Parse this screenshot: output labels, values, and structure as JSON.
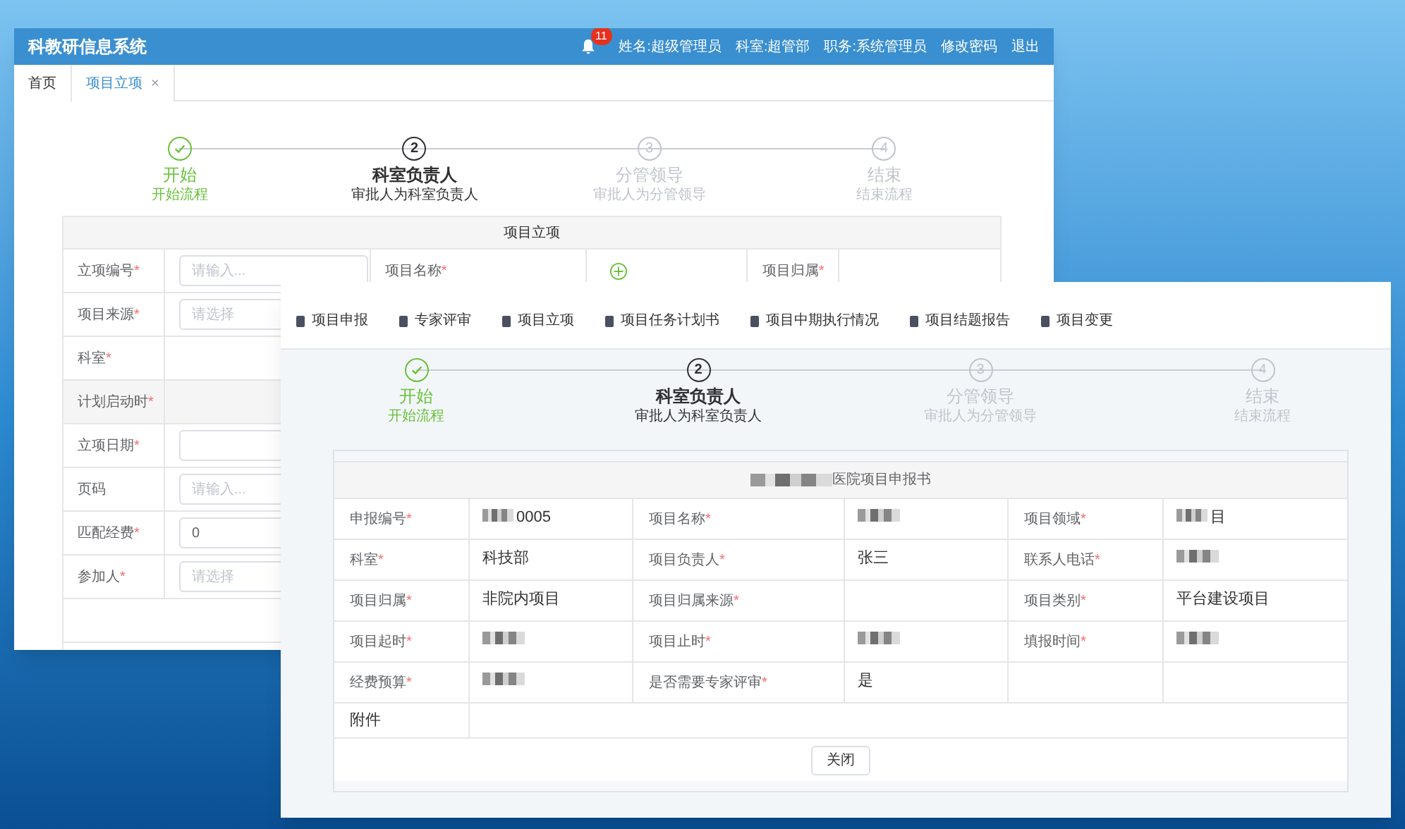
{
  "back_window": {
    "title": "科教研信息系统",
    "notification_count": "11",
    "user_links": [
      "姓名:超级管理员",
      "科室:超管部",
      "职务:系统管理员",
      "修改密码",
      "退出"
    ],
    "tabs": [
      {
        "label": "首页",
        "selected": false
      },
      {
        "label": "项目立项",
        "selected": true,
        "close": "×"
      }
    ],
    "steps": [
      {
        "title": "开始",
        "subtitle": "开始流程",
        "kind": "done"
      },
      {
        "number": "2",
        "title": "科室负责人",
        "subtitle": "审批人为科室负责人",
        "kind": "current"
      },
      {
        "number": "3",
        "title": "分管领导",
        "subtitle": "审批人为分管领导",
        "kind": "pending"
      },
      {
        "number": "4",
        "title": "结束",
        "subtitle": "结束流程",
        "kind": "pending"
      }
    ],
    "form": {
      "title": "项目立项",
      "top_row": [
        {
          "label": "立项编号",
          "mark": "*",
          "placeholder": "请输入..."
        },
        {
          "label": "项目名称",
          "mark": "*",
          "add_button": true
        },
        {
          "label": "项目归属",
          "mark": "*"
        }
      ],
      "rows": [
        {
          "label": "项目来源",
          "mark": "*",
          "placeholder": "请选择"
        },
        {
          "label": "科室",
          "mark": "*"
        },
        {
          "label": "计划启动时",
          "mark": "*",
          "shaded": true
        },
        {
          "label": "立项日期",
          "mark": "*",
          "input": true
        },
        {
          "label": "页码",
          "placeholder": "请输入..."
        },
        {
          "label": "匹配经费",
          "mark": "*",
          "value": "0"
        },
        {
          "label": "参加人",
          "mark": "*",
          "placeholder": "请选择"
        }
      ]
    }
  },
  "front_window": {
    "nav": [
      "项目申报",
      "专家评审",
      "项目立项",
      "项目任务计划书",
      "项目中期执行情况",
      "项目结题报告",
      "项目变更"
    ],
    "steps": [
      {
        "title": "开始",
        "subtitle": "开始流程",
        "kind": "done"
      },
      {
        "number": "2",
        "title": "科室负责人",
        "subtitle": "审批人为科室负责人",
        "kind": "current"
      },
      {
        "number": "3",
        "title": "分管领导",
        "subtitle": "审批人为分管领导",
        "kind": "pending"
      },
      {
        "number": "4",
        "title": "结束",
        "subtitle": "结束流程",
        "kind": "pending"
      }
    ],
    "form": {
      "title": "医院项目申报书",
      "title_redacted": true,
      "rows": [
        {
          "pairs": [
            {
              "label": "申报编号",
              "mark": "*",
              "value": "0005",
              "redacted": true
            },
            {
              "label": "项目名称",
              "mark": "*",
              "redacted": true
            },
            {
              "label": "项目领域",
              "mark": "*",
              "value": "目",
              "redacted": true
            }
          ]
        },
        {
          "pairs": [
            {
              "label": "科室",
              "mark": "*",
              "value": "科技部"
            },
            {
              "label": "项目负责人",
              "mark": "*",
              "value": "张三"
            },
            {
              "label": "联系人电话",
              "mark": "*",
              "redacted": true
            }
          ]
        },
        {
          "pairs": [
            {
              "label": "项目归属",
              "mark": "*",
              "value": "非院内项目"
            },
            {
              "label": "项目归属来源",
              "mark": "*"
            },
            {
              "label": "项目类别",
              "mark": "*",
              "value": "平台建设项目"
            }
          ]
        },
        {
          "pairs": [
            {
              "label": "项目起时",
              "mark": "*",
              "redacted": true
            },
            {
              "label": "项目止时",
              "mark": "*",
              "redacted": true
            },
            {
              "label": "填报时间",
              "mark": "*",
              "redacted": true
            }
          ]
        },
        {
          "pairs": [
            {
              "label": "经费预算",
              "mark": "*",
              "redacted": true
            },
            {
              "label": "是否需要专家评审",
              "mark": "*",
              "value": "是"
            }
          ]
        }
      ],
      "attachment": {
        "label": "附件"
      },
      "button": "关闭"
    }
  }
}
